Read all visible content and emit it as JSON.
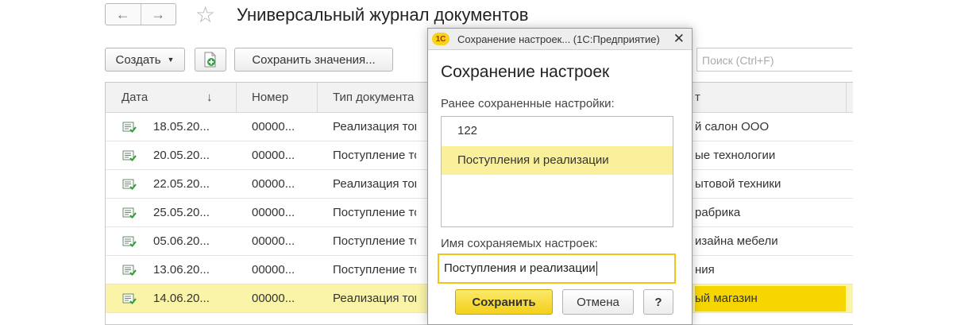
{
  "window": {
    "title": "Универсальный журнал документов",
    "nav_back": "←",
    "nav_forward": "→",
    "favorite_icon": "☆"
  },
  "toolbar": {
    "create_label": "Создать",
    "create_caret": "▼",
    "save_values_label": "Сохранить значения...",
    "search_placeholder": "Поиск (Ctrl+F)"
  },
  "table": {
    "headers": {
      "date": "Дата",
      "sort_indicator": "↓",
      "number": "Номер",
      "doc_type": "Тип документа",
      "counterparty_partial": "т"
    },
    "rows": [
      {
        "date": "18.05.20...",
        "number": "00000...",
        "type": "Реализация тов...",
        "counterparty": "й салон ООО"
      },
      {
        "date": "20.05.20...",
        "number": "00000...",
        "type": "Поступление тов...",
        "counterparty": "ые технологии"
      },
      {
        "date": "22.05.20...",
        "number": "00000...",
        "type": "Реализация тов...",
        "counterparty": "ытовой техники"
      },
      {
        "date": "25.05.20...",
        "number": "00000...",
        "type": "Поступление тов...",
        "counterparty": "рабрика"
      },
      {
        "date": "05.06.20...",
        "number": "00000...",
        "type": "Поступление тов...",
        "counterparty": "изайна мебели"
      },
      {
        "date": "13.06.20...",
        "number": "00000...",
        "type": "Поступление тов...",
        "counterparty": "ния"
      },
      {
        "date": "14.06.20...",
        "number": "00000...",
        "type": "Реализация тов...",
        "counterparty": "ый магазин"
      }
    ]
  },
  "dialog": {
    "window_title": "Сохранение настроек... (1С:Предприятие)",
    "logo_text": "1С",
    "close_glyph": "✕",
    "heading": "Сохранение настроек",
    "saved_label": "Ранее сохраненные настройки:",
    "saved_items": [
      "122",
      "Поступления и реализации"
    ],
    "name_label": "Имя сохраняемых настроек:",
    "name_value": "Поступления и реализации",
    "save_button": "Сохранить",
    "cancel_button": "Отмена",
    "help_button": "?"
  },
  "colors": {
    "selected_row": "#faf4a8",
    "selected_accent": "#f7d600",
    "primary_button": "#f3d01a",
    "input_focus_border": "#f0c419",
    "doc_icon_green": "#2f9a3a"
  }
}
